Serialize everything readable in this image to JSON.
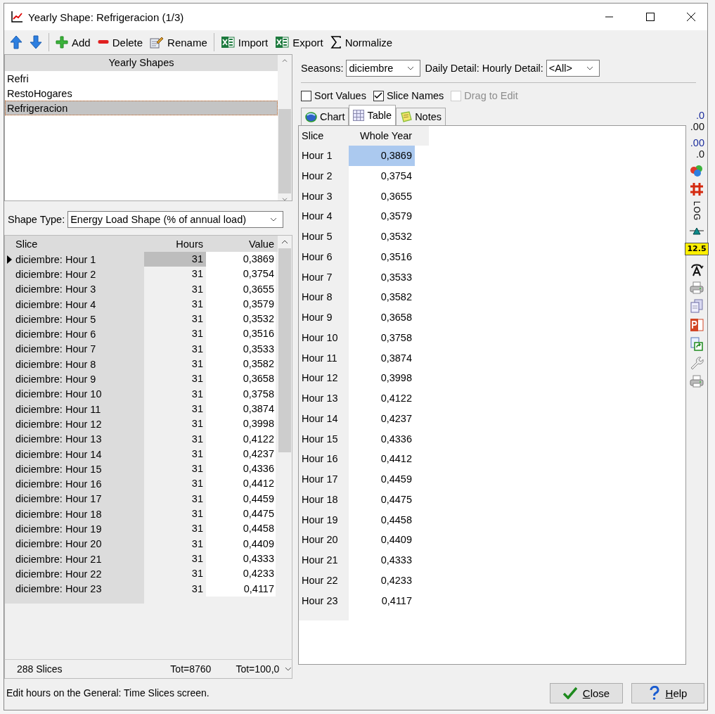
{
  "window": {
    "title": "Yearly Shape: Refrigeracion (1/3)"
  },
  "toolbar": [
    {
      "kind": "up"
    },
    {
      "kind": "down"
    },
    {
      "kind": "sep"
    },
    {
      "kind": "add",
      "label": "Add"
    },
    {
      "kind": "delete",
      "label": "Delete"
    },
    {
      "kind": "rename",
      "label": "Rename"
    },
    {
      "kind": "sep"
    },
    {
      "kind": "excel",
      "label": "Import"
    },
    {
      "kind": "excel",
      "label": "Export"
    },
    {
      "kind": "sigma",
      "label": "Normalize"
    }
  ],
  "shapes": {
    "header": "Yearly Shapes",
    "items": [
      {
        "label": "Refri",
        "selected": false
      },
      {
        "label": "RestoHogares",
        "selected": false
      },
      {
        "label": "Refrigeracion",
        "selected": true
      }
    ]
  },
  "shape_type": {
    "label": "Shape Type:",
    "value": "Energy Load Shape (% of annual load)"
  },
  "left_table": {
    "columns": [
      "Slice",
      "Hours",
      "Value"
    ],
    "rows": [
      {
        "slice": "diciembre: Hour 1",
        "hours": "31",
        "value": "0,3869",
        "selected": true
      },
      {
        "slice": "diciembre: Hour 2",
        "hours": "31",
        "value": "0,3754",
        "selected": false
      },
      {
        "slice": "diciembre: Hour 3",
        "hours": "31",
        "value": "0,3655",
        "selected": false
      },
      {
        "slice": "diciembre: Hour 4",
        "hours": "31",
        "value": "0,3579",
        "selected": false
      },
      {
        "slice": "diciembre: Hour 5",
        "hours": "31",
        "value": "0,3532",
        "selected": false
      },
      {
        "slice": "diciembre: Hour 6",
        "hours": "31",
        "value": "0,3516",
        "selected": false
      },
      {
        "slice": "diciembre: Hour 7",
        "hours": "31",
        "value": "0,3533",
        "selected": false
      },
      {
        "slice": "diciembre: Hour 8",
        "hours": "31",
        "value": "0,3582",
        "selected": false
      },
      {
        "slice": "diciembre: Hour 9",
        "hours": "31",
        "value": "0,3658",
        "selected": false
      },
      {
        "slice": "diciembre: Hour 10",
        "hours": "31",
        "value": "0,3758",
        "selected": false
      },
      {
        "slice": "diciembre: Hour 11",
        "hours": "31",
        "value": "0,3874",
        "selected": false
      },
      {
        "slice": "diciembre: Hour 12",
        "hours": "31",
        "value": "0,3998",
        "selected": false
      },
      {
        "slice": "diciembre: Hour 13",
        "hours": "31",
        "value": "0,4122",
        "selected": false
      },
      {
        "slice": "diciembre: Hour 14",
        "hours": "31",
        "value": "0,4237",
        "selected": false
      },
      {
        "slice": "diciembre: Hour 15",
        "hours": "31",
        "value": "0,4336",
        "selected": false
      },
      {
        "slice": "diciembre: Hour 16",
        "hours": "31",
        "value": "0,4412",
        "selected": false
      },
      {
        "slice": "diciembre: Hour 17",
        "hours": "31",
        "value": "0,4459",
        "selected": false
      },
      {
        "slice": "diciembre: Hour 18",
        "hours": "31",
        "value": "0,4475",
        "selected": false
      },
      {
        "slice": "diciembre: Hour 19",
        "hours": "31",
        "value": "0,4458",
        "selected": false
      },
      {
        "slice": "diciembre: Hour 20",
        "hours": "31",
        "value": "0,4409",
        "selected": false
      },
      {
        "slice": "diciembre: Hour 21",
        "hours": "31",
        "value": "0,4333",
        "selected": false
      },
      {
        "slice": "diciembre: Hour 22",
        "hours": "31",
        "value": "0,4233",
        "selected": false
      },
      {
        "slice": "diciembre: Hour 23",
        "hours": "31",
        "value": "0,4117",
        "selected": false
      }
    ],
    "footer": [
      "288 Slices",
      "Tot=8760",
      "Tot=100,0"
    ]
  },
  "filters": [
    {
      "kind": "dropdown",
      "label": "Seasons:",
      "value": "diciembre"
    },
    {
      "kind": "label",
      "label": "Daily Detail:"
    },
    {
      "kind": "dropdown",
      "label": "Hourly Detail:",
      "value": "<All>"
    }
  ],
  "options": [
    {
      "label": "Sort Values",
      "checked": false,
      "disabled": false
    },
    {
      "label": "Slice Names",
      "checked": true,
      "disabled": false
    },
    {
      "label": "Drag to Edit",
      "checked": false,
      "disabled": true
    }
  ],
  "tabs": [
    {
      "kind": "chart",
      "label": "Chart",
      "selected": false
    },
    {
      "kind": "table",
      "label": "Table",
      "selected": true
    },
    {
      "kind": "notes",
      "label": "Notes",
      "selected": false
    }
  ],
  "right_table": {
    "columns": [
      "Slice",
      "Whole Year"
    ],
    "rows": [
      {
        "slice": "Hour 1",
        "value": "0,3869",
        "selected": true
      },
      {
        "slice": "Hour 2",
        "value": "0,3754",
        "selected": false
      },
      {
        "slice": "Hour 3",
        "value": "0,3655",
        "selected": false
      },
      {
        "slice": "Hour 4",
        "value": "0,3579",
        "selected": false
      },
      {
        "slice": "Hour 5",
        "value": "0,3532",
        "selected": false
      },
      {
        "slice": "Hour 6",
        "value": "0,3516",
        "selected": false
      },
      {
        "slice": "Hour 7",
        "value": "0,3533",
        "selected": false
      },
      {
        "slice": "Hour 8",
        "value": "0,3582",
        "selected": false
      },
      {
        "slice": "Hour 9",
        "value": "0,3658",
        "selected": false
      },
      {
        "slice": "Hour 10",
        "value": "0,3758",
        "selected": false
      },
      {
        "slice": "Hour 11",
        "value": "0,3874",
        "selected": false
      },
      {
        "slice": "Hour 12",
        "value": "0,3998",
        "selected": false
      },
      {
        "slice": "Hour 13",
        "value": "0,4122",
        "selected": false
      },
      {
        "slice": "Hour 14",
        "value": "0,4237",
        "selected": false
      },
      {
        "slice": "Hour 15",
        "value": "0,4336",
        "selected": false
      },
      {
        "slice": "Hour 16",
        "value": "0,4412",
        "selected": false
      },
      {
        "slice": "Hour 17",
        "value": "0,4459",
        "selected": false
      },
      {
        "slice": "Hour 18",
        "value": "0,4475",
        "selected": false
      },
      {
        "slice": "Hour 19",
        "value": "0,4458",
        "selected": false
      },
      {
        "slice": "Hour 20",
        "value": "0,4409",
        "selected": false
      },
      {
        "slice": "Hour 21",
        "value": "0,4333",
        "selected": false
      },
      {
        "slice": "Hour 22",
        "value": "0,4233",
        "selected": false
      },
      {
        "slice": "Hour 23",
        "value": "0,4117",
        "selected": false
      }
    ]
  },
  "side_tools": [
    {
      "kind": "decimals-up",
      "top": ".0",
      "bottom": ".00"
    },
    {
      "kind": "decimals-down",
      "top": ".00",
      "bottom": ".0"
    },
    {
      "kind": "colors"
    },
    {
      "kind": "grid"
    },
    {
      "kind": "log",
      "label": "LOG"
    },
    {
      "kind": "balance"
    },
    {
      "kind": "number",
      "label": "12.5"
    },
    {
      "kind": "font"
    },
    {
      "kind": "print"
    },
    {
      "kind": "copy"
    },
    {
      "kind": "powerpoint"
    },
    {
      "kind": "export"
    },
    {
      "kind": "wrench"
    },
    {
      "kind": "print"
    }
  ],
  "status_bar": "Edit hours on the General: Time Slices screen.",
  "buttons": [
    {
      "kind": "close",
      "label": "Close"
    },
    {
      "kind": "help",
      "label": "Help"
    }
  ]
}
